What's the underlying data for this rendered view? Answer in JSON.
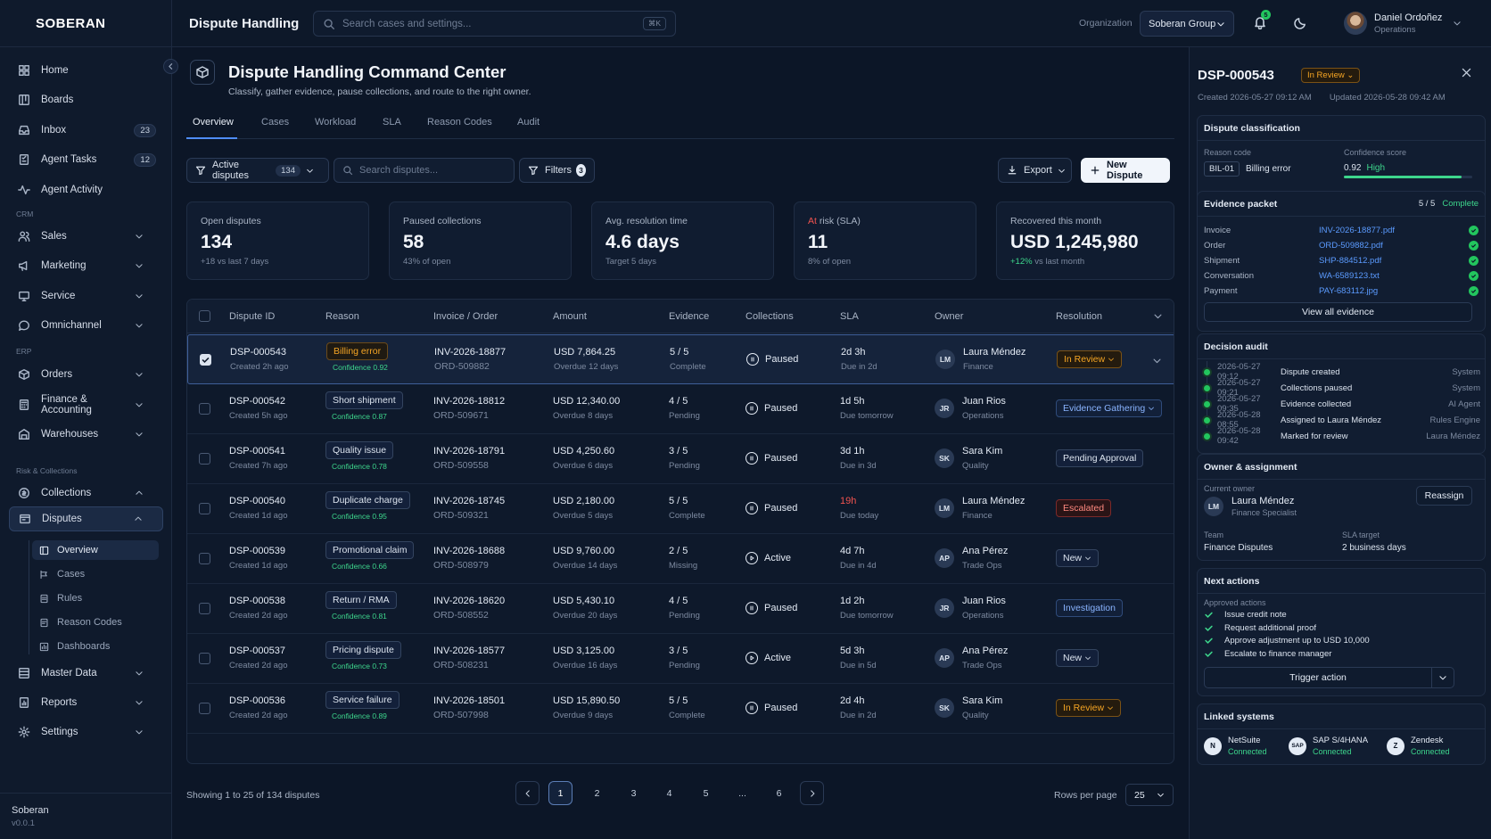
{
  "app": {
    "logo": "SOBERAN",
    "brand": "Soberan",
    "version": "v0.0.1"
  },
  "sidebar": {
    "items": [
      {
        "label": "Home",
        "icon": "grid-icon"
      },
      {
        "label": "Boards",
        "icon": "boards-icon"
      },
      {
        "label": "Inbox",
        "icon": "inbox-icon",
        "count": "23"
      },
      {
        "label": "Agent Tasks",
        "icon": "tasks-icon",
        "count": "12"
      },
      {
        "label": "Agent Activity",
        "icon": "activity-icon"
      }
    ],
    "sections": {
      "crm": "CRM",
      "erp": "ERP",
      "risk": "Risk & Collections"
    },
    "crm": [
      {
        "label": "Sales"
      },
      {
        "label": "Marketing"
      },
      {
        "label": "Service"
      },
      {
        "label": "Omnichannel"
      }
    ],
    "erp": [
      {
        "label": "Orders"
      },
      {
        "label": "Finance & Accounting"
      },
      {
        "label": "Warehouses"
      }
    ],
    "risk": [
      {
        "label": "Collections"
      },
      {
        "label": "Disputes"
      }
    ],
    "disputes_sub": [
      {
        "label": "Overview"
      },
      {
        "label": "Cases"
      },
      {
        "label": "Rules"
      },
      {
        "label": "Reason Codes"
      },
      {
        "label": "Dashboards"
      }
    ],
    "bottom": [
      {
        "label": "Master Data"
      },
      {
        "label": "Reports"
      },
      {
        "label": "Settings"
      }
    ]
  },
  "topbar": {
    "title": "Dispute Handling",
    "search_placeholder": "Search cases and settings...",
    "shortcut": "⌘K",
    "org_label": "Organization",
    "org_value": "Soberan Group",
    "notif_count": "5",
    "user_name": "Daniel Ordoñez",
    "user_role": "Operations"
  },
  "header": {
    "title": "Dispute Handling Command Center",
    "subtitle": "Classify, gather evidence, pause collections, and route to the right owner."
  },
  "tabs": [
    "Overview",
    "Cases",
    "Workload",
    "SLA",
    "Reason Codes",
    "Audit"
  ],
  "toolbar": {
    "active_label": "Active disputes",
    "active_count": "134",
    "search_placeholder": "Search disputes...",
    "filters_label": "Filters",
    "filters_count": "3",
    "export_label": "Export",
    "new_label": "New Dispute"
  },
  "stats": [
    {
      "label": "Open disputes",
      "value": "134",
      "delta": "+18 vs last 7 days"
    },
    {
      "label": "Paused collections",
      "value": "58",
      "delta": "43% of open"
    },
    {
      "label": "Avg. resolution time",
      "value": "4.6 days",
      "delta": "Target 5 days"
    },
    {
      "label_a": "At",
      "label_b": " risk (SLA)",
      "value": "11",
      "delta": "8% of open"
    },
    {
      "label": "Recovered this month",
      "value": "USD 1,245,980",
      "delta_a": "+12%",
      "delta_b": " vs last month"
    }
  ],
  "columns": [
    "Dispute ID",
    "Reason",
    "Invoice / Order",
    "Amount",
    "Evidence",
    "Collections",
    "SLA",
    "Owner",
    "Resolution"
  ],
  "rows": [
    {
      "id": "DSP-000543",
      "created": "Created 2h ago",
      "reason": "Billing error",
      "conf": "Confidence 0.92",
      "invoice": "INV-2026-18877",
      "order": "ORD-509882",
      "amount": "USD 7,864.25",
      "overdue": "Overdue 12 days",
      "evidence": "5 / 5",
      "ev_status": "Complete",
      "collections": "Paused",
      "sla": "2d 3h",
      "due": "Due in 2d",
      "initials": "LM",
      "owner": "Laura Méndez",
      "team": "Finance",
      "resolution": "In Review"
    },
    {
      "id": "DSP-000542",
      "created": "Created 5h ago",
      "reason": "Short shipment",
      "conf": "Confidence 0.87",
      "invoice": "INV-2026-18812",
      "order": "ORD-509671",
      "amount": "USD 12,340.00",
      "overdue": "Overdue 8 days",
      "evidence": "4 / 5",
      "ev_status": "Pending",
      "collections": "Paused",
      "sla": "1d 5h",
      "due": "Due tomorrow",
      "initials": "JR",
      "owner": "Juan Rios",
      "team": "Operations",
      "resolution": "Evidence Gathering"
    },
    {
      "id": "DSP-000541",
      "created": "Created 7h ago",
      "reason": "Quality issue",
      "conf": "Confidence 0.78",
      "invoice": "INV-2026-18791",
      "order": "ORD-509558",
      "amount": "USD 4,250.60",
      "overdue": "Overdue 6 days",
      "evidence": "3 / 5",
      "ev_status": "Pending",
      "collections": "Paused",
      "sla": "3d 1h",
      "due": "Due in 3d",
      "initials": "SK",
      "owner": "Sara Kim",
      "team": "Quality",
      "resolution": "Pending Approval"
    },
    {
      "id": "DSP-000540",
      "created": "Created 1d ago",
      "reason": "Duplicate charge",
      "conf": "Confidence 0.95",
      "invoice": "INV-2026-18745",
      "order": "ORD-509321",
      "amount": "USD 2,180.00",
      "overdue": "Overdue 5 days",
      "evidence": "5 / 5",
      "ev_status": "Complete",
      "collections": "Paused",
      "sla": "19h",
      "due": "Due today",
      "initials": "LM",
      "owner": "Laura Méndez",
      "team": "Finance",
      "resolution": "Escalated"
    },
    {
      "id": "DSP-000539",
      "created": "Created 1d ago",
      "reason": "Promotional claim",
      "conf": "Confidence 0.66",
      "invoice": "INV-2026-18688",
      "order": "ORD-508979",
      "amount": "USD 9,760.00",
      "overdue": "Overdue 14 days",
      "evidence": "2 / 5",
      "ev_status": "Missing",
      "collections": "Active",
      "sla": "4d 7h",
      "due": "Due in 4d",
      "initials": "AP",
      "owner": "Ana Pérez",
      "team": "Trade Ops",
      "resolution": "New"
    },
    {
      "id": "DSP-000538",
      "created": "Created 2d ago",
      "reason": "Return / RMA",
      "conf": "Confidence 0.81",
      "invoice": "INV-2026-18620",
      "order": "ORD-508552",
      "amount": "USD 5,430.10",
      "overdue": "Overdue 20 days",
      "evidence": "4 / 5",
      "ev_status": "Pending",
      "collections": "Paused",
      "sla": "1d 2h",
      "due": "Due tomorrow",
      "initials": "JR",
      "owner": "Juan Rios",
      "team": "Operations",
      "resolution": "Investigation"
    },
    {
      "id": "DSP-000537",
      "created": "Created 2d ago",
      "reason": "Pricing dispute",
      "conf": "Confidence 0.73",
      "invoice": "INV-2026-18577",
      "order": "ORD-508231",
      "amount": "USD 3,125.00",
      "overdue": "Overdue 16 days",
      "evidence": "3 / 5",
      "ev_status": "Pending",
      "collections": "Active",
      "sla": "5d 3h",
      "due": "Due in 5d",
      "initials": "AP",
      "owner": "Ana Pérez",
      "team": "Trade Ops",
      "resolution": "New"
    },
    {
      "id": "DSP-000536",
      "created": "Created 2d ago",
      "reason": "Service failure",
      "conf": "Confidence 0.89",
      "invoice": "INV-2026-18501",
      "order": "ORD-507998",
      "amount": "USD 15,890.50",
      "overdue": "Overdue 9 days",
      "evidence": "5 / 5",
      "ev_status": "Complete",
      "collections": "Paused",
      "sla": "2d 4h",
      "due": "Due in 2d",
      "initials": "SK",
      "owner": "Sara Kim",
      "team": "Quality",
      "resolution": "In Review"
    }
  ],
  "pagination": {
    "info": "Showing 1 to 25 of 134 disputes",
    "pages": [
      "1",
      "2",
      "3",
      "4",
      "5",
      "...",
      "6"
    ],
    "rows_label": "Rows per page",
    "rows_value": "25"
  },
  "panel": {
    "id": "DSP-000543",
    "status": "In Review",
    "created": "Created 2026-05-27 09:12 AM",
    "updated": "Updated 2026-05-28 09:42 AM",
    "classification": {
      "title": "Dispute classification",
      "reason_label": "Reason code",
      "code": "BIL-01",
      "reason": "Billing error",
      "conf_label": "Confidence score",
      "conf_value": "0.92",
      "conf_level": "High",
      "confidence": 0.92
    },
    "evidence": {
      "title": "Evidence packet",
      "count": "5 / 5",
      "status": "Complete",
      "items": [
        {
          "k": "Invoice",
          "v": "INV-2026-18877.pdf"
        },
        {
          "k": "Order",
          "v": "ORD-509882.pdf"
        },
        {
          "k": "Shipment",
          "v": "SHP-884512.pdf"
        },
        {
          "k": "Conversation",
          "v": "WA-6589123.txt"
        },
        {
          "k": "Payment",
          "v": "PAY-683112.jpg"
        }
      ],
      "view_all": "View all evidence"
    },
    "audit": {
      "title": "Decision audit",
      "items": [
        {
          "t": "2026-05-27 09:12",
          "e": "Dispute created",
          "a": "System"
        },
        {
          "t": "2026-05-27 09:21",
          "e": "Collections paused",
          "a": "System"
        },
        {
          "t": "2026-05-27 09:35",
          "e": "Evidence collected",
          "a": "AI Agent"
        },
        {
          "t": "2026-05-28 08:55",
          "e": "Assigned to Laura Méndez",
          "a": "Rules Engine"
        },
        {
          "t": "2026-05-28 09:42",
          "e": "Marked for review",
          "a": "Laura Méndez"
        }
      ]
    },
    "owner": {
      "title": "Owner & assignment",
      "current_label": "Current owner",
      "initials": "LM",
      "name": "Laura Méndez",
      "role": "Finance Specialist",
      "reassign": "Reassign",
      "team_label": "Team",
      "team": "Finance Disputes",
      "sla_label": "SLA target",
      "sla": "2 business days"
    },
    "actions": {
      "title": "Next actions",
      "approved_label": "Approved actions",
      "items": [
        "Issue credit note",
        "Request additional proof",
        "Approve adjustment up to USD 10,000",
        "Escalate to finance manager"
      ],
      "trigger": "Trigger action"
    },
    "linked": {
      "title": "Linked systems",
      "items": [
        {
          "name": "NetSuite",
          "status": "Connected",
          "mark": "N"
        },
        {
          "name": "SAP S/4HANA",
          "status": "Connected",
          "mark": "SAP"
        },
        {
          "name": "Zendesk",
          "status": "Connected",
          "mark": "Z"
        }
      ]
    }
  }
}
